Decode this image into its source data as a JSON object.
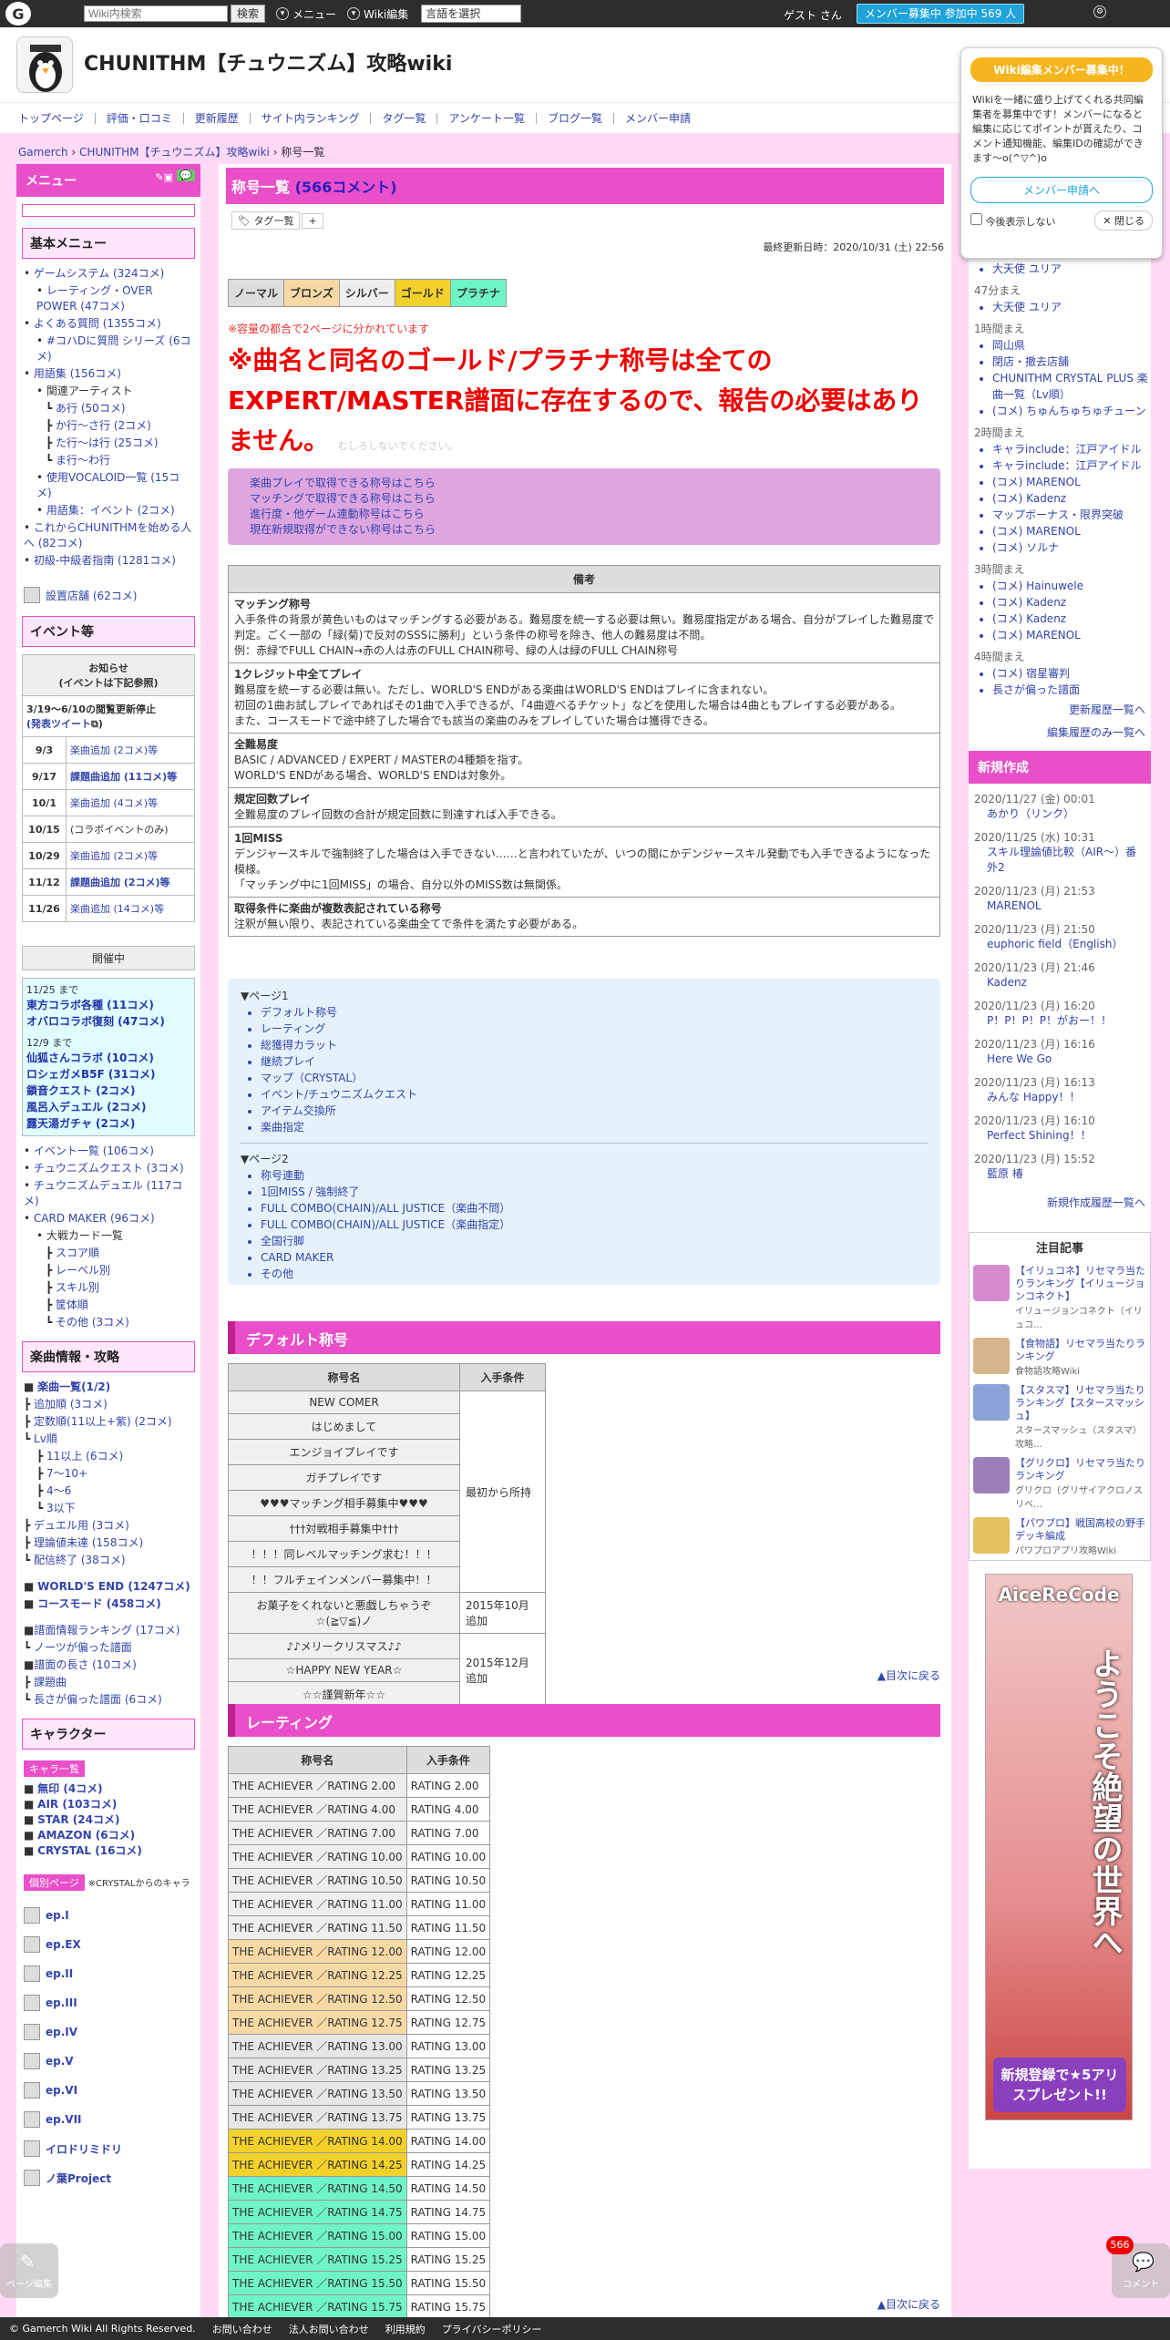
{
  "topbar": {
    "search_placeholder": "Wiki内検索",
    "search_btn": "検索",
    "menu": "メニュー",
    "wiki_edit": "Wiki編集",
    "lang": "言語を選択",
    "guest": "ゲスト さん",
    "member": "メンバー募集中 参加中 569 人"
  },
  "site": {
    "title": "CHUNITHM【チュウニズム】攻略wiki"
  },
  "nav": [
    "トップページ",
    "評価・口コミ",
    "更新履歴",
    "サイト内ランキング",
    "タグ一覧",
    "アンケート一覧",
    "ブログ一覧",
    "メンバー申請"
  ],
  "breadcrumb": {
    "root": "Gamerch",
    "wiki": "CHUNITHM【チュウニズム】攻略wiki",
    "current": "称号一覧"
  },
  "left": {
    "menu": "メニュー",
    "basic_title": "基本メニュー",
    "basic_items": [
      "ゲームシステム (324コメ)",
      "レーティング・OVER POWER (47コメ)",
      "よくある質問 (1355コメ)",
      "#コハDに質問 シリーズ (6コメ)",
      "用語集 (156コメ)",
      "関連アーティスト",
      "あ行 (50コメ)",
      "か行～さ行 (2コメ)",
      "た行～は行 (25コメ)",
      "ま行～わ行",
      "使用VOCALOID一覧 (15コメ)",
      "用語集：イベント (2コメ)",
      "これからCHUNITHMを始める人へ (82コメ)",
      "初級-中級者指南 (1281コメ)"
    ],
    "equip": "設置店舗 (62コメ)",
    "event_title": "イベント等",
    "notice_head": "お知らせ\n(イベントは下記参照)",
    "notice_stop": "3/19～6/10の閲覧更新停止",
    "notice_tweet": "(発表ツイート",
    "events": [
      {
        "d": "9/3",
        "t": "楽曲追加 (2コメ)等"
      },
      {
        "d": "9/17",
        "t": "課題曲追加 (11コメ)等"
      },
      {
        "d": "10/1",
        "t": "楽曲追加 (4コメ)等"
      },
      {
        "d": "10/15",
        "t": "(コラボイベントのみ)"
      },
      {
        "d": "10/29",
        "t": "楽曲追加 (2コメ)等"
      },
      {
        "d": "11/12",
        "t": "課題曲追加 (2コメ)等"
      },
      {
        "d": "11/26",
        "t": "楽曲追加 (14コメ)等"
      }
    ],
    "kaisai": "開催中",
    "k1_date": "11/25 まで",
    "k1": [
      "東方コラボ各種 (11コメ)",
      "オバロコラボ復刻 (47コメ)"
    ],
    "k2_date": "12/9 まで",
    "k2": [
      "仙狐さんコラボ (10コメ)",
      "ロシェガメB5F (31コメ)",
      "鎖音クエスト (2コメ)",
      "風呂入デュエル (2コメ)",
      "露天湯ガチャ (2コメ)"
    ],
    "ev_links": [
      "イベント一覧 (106コメ)",
      "チュウニズムクエスト (3コメ)",
      "チュウニズムデュエル (117コメ)",
      "CARD MAKER (96コメ)",
      "大戦カード一覧",
      "スコア順",
      "レーベル別",
      "スキル別",
      "筐体順",
      "その他 (3コメ)"
    ],
    "music_title": "楽曲情報・攻略",
    "music_items": [
      "楽曲一覧(1/2)",
      "追加順 (3コメ)",
      "定数順(11以上+紫) (2コメ)",
      "Lv順",
      "11以上 (6コメ)",
      "7～10+",
      "4～6",
      "3以下",
      "デュエル用 (3コメ)",
      "理論値未達 (158コメ)",
      "配信終了 (38コメ)"
    ],
    "we": "WORLD'S END (1247コメ)",
    "course": "コースモード (458コメ)",
    "music2": [
      "譜面情報ランキング (17コメ)",
      "ノーツが偏った譜面",
      "譜面の長さ (10コメ)",
      "課題曲",
      "長さが偏った譜面 (6コメ)"
    ],
    "chara_title": "キャラクター",
    "chara_tag": "キャラ一覧",
    "chara_items": [
      "無印 (4コメ)",
      "AIR (103コメ)",
      "STAR (24コメ)",
      "AMAZON (6コメ)",
      "CRYSTAL (16コメ)"
    ],
    "indiv_tag": "個別ページ",
    "indiv_note": "※CRYSTALからのキャラ",
    "eps": [
      "ep.I",
      "ep.EX",
      "ep.II",
      "ep.III",
      "ep.IV",
      "ep.V",
      "ep.VI",
      "ep.VII"
    ],
    "last1": "イロドリミドリ",
    "last2": "ノ葉Project"
  },
  "main": {
    "title": "称号一覧",
    "comments": "(566コメント)",
    "tag_list": "タグ一覧",
    "updated": "最終更新日時：2020/10/31 (土) 22:56",
    "ranks": [
      {
        "label": "ノーマル",
        "color": "#dddddd"
      },
      {
        "label": "ブロンズ",
        "color": "#f6d9a5"
      },
      {
        "label": "シルバー",
        "color": "#eeeeee"
      },
      {
        "label": "ゴールド",
        "color": "#f2d12a"
      },
      {
        "label": "プラチナ",
        "color": "#6ff3c8"
      }
    ],
    "note_small": "※容量の都合で2ページに分かれています",
    "note_big": "※曲名と同名のゴールド/プラチナ称号は全てのEXPERT/MASTER譜面に存在するので、報告の必要はありません。",
    "note_hidden": "むしろしないでください。",
    "links": [
      "楽曲プレイで取得できる称号はこちら",
      "マッチングで取得できる称号はこちら",
      "進行度・他ゲーム連動称号はこちら",
      "現在新規取得ができない称号はこちら"
    ],
    "bikou_head": "備考",
    "bikou": [
      {
        "h": "マッチング称号",
        "l": [
          "入手条件の背景が黄色いものはマッチングする必要がある。難易度を統一する必要は無い。難易度指定がある場合、自分がプレイした難易度で判定。ごく一部の「緑(菊)で反対のSSSに勝利」という条件の称号を除き、他人の難易度は不問。",
          "例：赤緑でFULL CHAIN→赤の人は赤のFULL CHAIN称号、緑の人は緑のFULL CHAIN称号"
        ]
      },
      {
        "h": "1クレジット中全てプレイ",
        "l": [
          "難易度を統一する必要は無い。ただし、WORLD'S ENDがある楽曲はWORLD'S ENDはプレイに含まれない。",
          "初回の1曲お試しプレイであればその1曲で入手できるが、「4曲遊べるチケット」などを使用した場合は4曲ともプレイする必要がある。",
          "また、コースモードで途中終了した場合でも該当の楽曲のみをプレイしていた場合は獲得できる。"
        ]
      },
      {
        "h": "全難易度",
        "l": [
          "BASIC / ADVANCED / EXPERT / MASTERの4種類を指す。",
          "WORLD'S ENDがある場合、WORLD'S ENDは対象外。"
        ]
      },
      {
        "h": "規定回数プレイ",
        "l": [
          "全難易度のプレイ回数の合計が規定回数に到達すれば入手できる。"
        ]
      },
      {
        "h": "1回MISS",
        "l": [
          "デンジャースキルで強制終了した場合は入手できない……と言われていたが、いつの間にかデンジャースキル発動でも入手できるようになった模様。",
          "「マッチング中に1回MISS」の場合、自分以外のMISS数は無関係。"
        ]
      },
      {
        "h": "取得条件に楽曲が複数表記されている称号",
        "l": [
          "注釈が無い限り、表記されている楽曲全てで条件を満たす必要がある。"
        ]
      }
    ],
    "toc_p1": "▼ページ1",
    "toc1": [
      "デフォルト称号",
      "レーティング",
      "総獲得カラット",
      "継続プレイ",
      "マップ（CRYSTAL）",
      "イベント/チュウニズムクエスト",
      "アイテム交換所",
      "楽曲指定"
    ],
    "toc_p2": "▼ページ2",
    "toc2": [
      "称号連動",
      "1回MISS / 強制終了",
      "FULL COMBO(CHAIN)/ALL JUSTICE（楽曲不問）",
      "FULL COMBO(CHAIN)/ALL JUSTICE（楽曲指定）",
      "全国行脚",
      "CARD MAKER",
      "その他"
    ],
    "sec_default": "デフォルト称号",
    "th_name": "称号名",
    "th_cond": "入手条件",
    "defaults": [
      "NEW COMER",
      "はじめまして",
      "エンジョイプレイです",
      "ガチプレイです",
      "♥♥♥マッチング相手募集中♥♥♥",
      "†††対戦相手募集中†††",
      "！！！同レベルマッチング求む！！！",
      "！！フルチェインメンバー募集中！！",
      "お菓子をくれないと悪戯しちゃうぞ ☆(≧▽≦)ノ",
      "♪♪メリークリスマス♪♪",
      "☆HAPPY NEW YEAR☆",
      "☆☆謹賀新年☆☆"
    ],
    "cond_initial": "最初から所持",
    "cond_oct": "2015年10月追加",
    "cond_dec": "2015年12月追加",
    "to_top": "▲目次に戻る",
    "sec_rating": "レーティング",
    "ratings": [
      {
        "n": "THE ACHIEVER ／RATING 2.00",
        "c": "RATING 2.00",
        "bg": "#eeeeee"
      },
      {
        "n": "THE ACHIEVER ／RATING 4.00",
        "c": "RATING 4.00",
        "bg": "#eeeeee"
      },
      {
        "n": "THE ACHIEVER ／RATING 7.00",
        "c": "RATING 7.00",
        "bg": "#eeeeee"
      },
      {
        "n": "THE ACHIEVER ／RATING 10.00",
        "c": "RATING 10.00",
        "bg": "#eeeeee"
      },
      {
        "n": "THE ACHIEVER ／RATING 10.50",
        "c": "RATING 10.50",
        "bg": "#eeeeee"
      },
      {
        "n": "THE ACHIEVER ／RATING 11.00",
        "c": "RATING 11.00",
        "bg": "#eeeeee"
      },
      {
        "n": "THE ACHIEVER ／RATING 11.50",
        "c": "RATING 11.50",
        "bg": "#eeeeee"
      },
      {
        "n": "THE ACHIEVER ／RATING 12.00",
        "c": "RATING 12.00",
        "bg": "#f6d9a5"
      },
      {
        "n": "THE ACHIEVER ／RATING 12.25",
        "c": "RATING 12.25",
        "bg": "#f6d9a5"
      },
      {
        "n": "THE ACHIEVER ／RATING 12.50",
        "c": "RATING 12.50",
        "bg": "#f6d9a5"
      },
      {
        "n": "THE ACHIEVER ／RATING 12.75",
        "c": "RATING 12.75",
        "bg": "#f6d9a5"
      },
      {
        "n": "THE ACHIEVER ／RATING 13.00",
        "c": "RATING 13.00",
        "bg": "#e6e6e6"
      },
      {
        "n": "THE ACHIEVER ／RATING 13.25",
        "c": "RATING 13.25",
        "bg": "#e6e6e6"
      },
      {
        "n": "THE ACHIEVER ／RATING 13.50",
        "c": "RATING 13.50",
        "bg": "#e6e6e6"
      },
      {
        "n": "THE ACHIEVER ／RATING 13.75",
        "c": "RATING 13.75",
        "bg": "#e6e6e6"
      },
      {
        "n": "THE ACHIEVER ／RATING 14.00",
        "c": "RATING 14.00",
        "bg": "#f2d12a"
      },
      {
        "n": "THE ACHIEVER ／RATING 14.25",
        "c": "RATING 14.25",
        "bg": "#f2d12a"
      },
      {
        "n": "THE ACHIEVER ／RATING 14.50",
        "c": "RATING 14.50",
        "bg": "#6ff3c8"
      },
      {
        "n": "THE ACHIEVER ／RATING 14.75",
        "c": "RATING 14.75",
        "bg": "#6ff3c8"
      },
      {
        "n": "THE ACHIEVER ／RATING 15.00",
        "c": "RATING 15.00",
        "bg": "#6ff3c8"
      },
      {
        "n": "THE ACHIEVER ／RATING 15.25",
        "c": "RATING 15.25",
        "bg": "#6ff3c8"
      },
      {
        "n": "THE ACHIEVER ／RATING 15.50",
        "c": "RATING 15.50",
        "bg": "#6ff3c8"
      },
      {
        "n": "THE ACHIEVER ／RATING 15.75",
        "c": "RATING 15.75",
        "bg": "#6ff3c8"
      }
    ]
  },
  "right": {
    "popup_title": "Wiki編集メンバー募集中！",
    "popup_body": "Wikiを一緒に盛り上げてくれる共同編集者を募集中です！メンバーになると編集に応じてポイントが貰えたり、コメント通知機能、編集IDの確認ができます～o(^▽^)o",
    "popup_btn": "メンバー申請へ",
    "popup_hide": "今後表示しない",
    "popup_close": "閉じる",
    "recent": [
      {
        "time": "",
        "items": [
          "大天使 ユリア"
        ]
      },
      {
        "time": "47分まえ",
        "items": [
          "大天使 ユリア"
        ]
      },
      {
        "time": "1時間まえ",
        "items": [
          "岡山県",
          "閉店・撤去店舗",
          "CHUNITHM CRYSTAL PLUS 楽曲一覧（Lv順）",
          "(コメ) ちゅんちゅちゅチューン"
        ]
      },
      {
        "time": "2時間まえ",
        "items": [
          "キャラinclude：江戸アイドル",
          "キャラinclude：江戸アイドル",
          "(コメ) MARENOL",
          "(コメ) Kadenz",
          "マップボーナス・限界突破",
          "(コメ) MARENOL",
          "(コメ) ソルナ"
        ]
      },
      {
        "time": "3時間まえ",
        "items": [
          "(コメ) Hainuwele",
          "(コメ) Kadenz",
          "(コメ) Kadenz",
          "(コメ) MARENOL"
        ]
      },
      {
        "time": "4時間まえ",
        "items": [
          "(コメ) 宿星審判",
          "長さが偏った譜面"
        ]
      }
    ],
    "more_hist": "更新履歴一覧へ",
    "more_edit": "編集履歴のみ一覧へ",
    "new_head": "新規作成",
    "new_items": [
      {
        "d": "2020/11/27 (金) 00:01",
        "t": "あかり（リンク）"
      },
      {
        "d": "2020/11/25 (水) 10:31",
        "t": "スキル理論値比較（AIR～）番外2"
      },
      {
        "d": "2020/11/23 (月) 21:53",
        "t": "MARENOL"
      },
      {
        "d": "2020/11/23 (月) 21:50",
        "t": "euphoric field（English）"
      },
      {
        "d": "2020/11/23 (月) 21:46",
        "t": "Kadenz"
      },
      {
        "d": "2020/11/23 (月) 16:20",
        "t": "P！P！P！P！がおー！！"
      },
      {
        "d": "2020/11/23 (月) 16:16",
        "t": "Here We Go"
      },
      {
        "d": "2020/11/23 (月) 16:13",
        "t": "みんな Happy！！"
      },
      {
        "d": "2020/11/23 (月) 16:10",
        "t": "Perfect Shining！！"
      },
      {
        "d": "2020/11/23 (月) 15:52",
        "t": "藍原 椿"
      }
    ],
    "more_new": "新規作成履歴一覧へ",
    "feat_head": "注目記事",
    "featured": [
      {
        "t": "【イリュコネ】リセマラ当たりランキング【イリュージョンコネクト】",
        "s": "イリュージョンコネクト（イリュコ…",
        "c": "#d58ad0"
      },
      {
        "t": "【食物語】リセマラ当たりランキング",
        "s": "食物語攻略Wiki",
        "c": "#d6b58a"
      },
      {
        "t": "【スタスマ】リセマラ当たりランキング【スタースマッシュ】",
        "s": "スタースマッシュ（スタスマ）攻略…",
        "c": "#8aa3d6"
      },
      {
        "t": "【グリクロ】リセマラ当たりランキング",
        "s": "グリクロ（グリザイアクロノスリベ…",
        "c": "#9a7fb8"
      },
      {
        "t": "【パワプロ】戦国高校の野手デッキ編成",
        "s": "パワプロアプリ攻略Wiki",
        "c": "#e3c160"
      }
    ],
    "ad_title": "AiceReCode",
    "ad_v": "ようこそ絶望の世界へ",
    "ad_btn": "新規登録で★5アリスプレゼント!!"
  },
  "footer": [
    "© Gamerch Wiki All Rights Reserved.",
    "お問い合わせ",
    "法人お問い合わせ",
    "利用規約",
    "プライバシーポリシー"
  ],
  "floats": {
    "left": "ページ編集",
    "right": "コメント",
    "badge": "566"
  }
}
